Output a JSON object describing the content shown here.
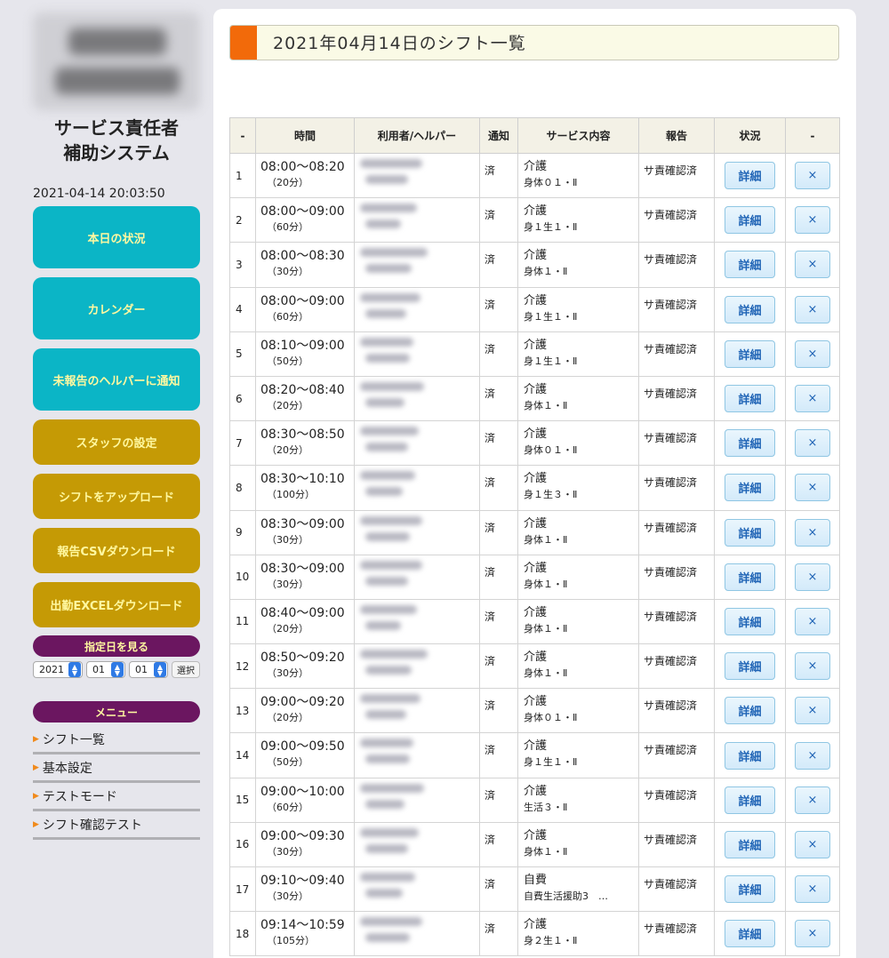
{
  "sidebar": {
    "app_title_line1": "サービス責任者",
    "app_title_line2": "補助システム",
    "datetime": "2021-04-14 20:03:50",
    "nav_buttons": [
      {
        "label": "本日の状況"
      },
      {
        "label": "カレンダー"
      },
      {
        "label": "未報告のヘルパーに通知"
      },
      {
        "label": "スタッフの設定"
      },
      {
        "label": "シフトをアップロード"
      },
      {
        "label": "報告CSVダウンロード"
      },
      {
        "label": "出勤EXCELダウンロード"
      }
    ],
    "date_picker": {
      "heading": "指定日を見る",
      "year": "2021",
      "month": "01",
      "day": "01",
      "select_label": "選択"
    },
    "menu": {
      "heading": "メニュー",
      "items": [
        {
          "label": "シフト一覧"
        },
        {
          "label": "基本設定"
        },
        {
          "label": "テストモード"
        },
        {
          "label": "シフト確認テスト"
        }
      ]
    }
  },
  "main": {
    "title": "2021年04月14日のシフト一覧",
    "table": {
      "headers": [
        "-",
        "時間",
        "利用者/ヘルパー",
        "通知",
        "サービス内容",
        "報告",
        "状況",
        "-"
      ],
      "detail_label": "詳細",
      "delete_label": "×",
      "rows": [
        {
          "no": "1",
          "time": "08:00〜08:20",
          "duration": "（20分）",
          "notice": "済",
          "category": "介護",
          "detail": "身体０１・Ⅱ",
          "report": "サ責確認済"
        },
        {
          "no": "2",
          "time": "08:00〜09:00",
          "duration": "（60分）",
          "notice": "済",
          "category": "介護",
          "detail": "身１生１・Ⅱ",
          "report": "サ責確認済"
        },
        {
          "no": "3",
          "time": "08:00〜08:30",
          "duration": "（30分）",
          "notice": "済",
          "category": "介護",
          "detail": "身体１・Ⅱ",
          "report": "サ責確認済"
        },
        {
          "no": "4",
          "time": "08:00〜09:00",
          "duration": "（60分）",
          "notice": "済",
          "category": "介護",
          "detail": "身１生１・Ⅱ",
          "report": "サ責確認済"
        },
        {
          "no": "5",
          "time": "08:10〜09:00",
          "duration": "（50分）",
          "notice": "済",
          "category": "介護",
          "detail": "身１生１・Ⅱ",
          "report": "サ責確認済"
        },
        {
          "no": "6",
          "time": "08:20〜08:40",
          "duration": "（20分）",
          "notice": "済",
          "category": "介護",
          "detail": "身体１・Ⅱ",
          "report": "サ責確認済"
        },
        {
          "no": "7",
          "time": "08:30〜08:50",
          "duration": "（20分）",
          "notice": "済",
          "category": "介護",
          "detail": "身体０１・Ⅱ",
          "report": "サ責確認済"
        },
        {
          "no": "8",
          "time": "08:30〜10:10",
          "duration": "（100分）",
          "notice": "済",
          "category": "介護",
          "detail": "身１生３・Ⅱ",
          "report": "サ責確認済"
        },
        {
          "no": "9",
          "time": "08:30〜09:00",
          "duration": "（30分）",
          "notice": "済",
          "category": "介護",
          "detail": "身体１・Ⅱ",
          "report": "サ責確認済"
        },
        {
          "no": "10",
          "time": "08:30〜09:00",
          "duration": "（30分）",
          "notice": "済",
          "category": "介護",
          "detail": "身体１・Ⅱ",
          "report": "サ責確認済"
        },
        {
          "no": "11",
          "time": "08:40〜09:00",
          "duration": "（20分）",
          "notice": "済",
          "category": "介護",
          "detail": "身体１・Ⅱ",
          "report": "サ責確認済"
        },
        {
          "no": "12",
          "time": "08:50〜09:20",
          "duration": "（30分）",
          "notice": "済",
          "category": "介護",
          "detail": "身体１・Ⅱ",
          "report": "サ責確認済"
        },
        {
          "no": "13",
          "time": "09:00〜09:20",
          "duration": "（20分）",
          "notice": "済",
          "category": "介護",
          "detail": "身体０１・Ⅱ",
          "report": "サ責確認済"
        },
        {
          "no": "14",
          "time": "09:00〜09:50",
          "duration": "（50分）",
          "notice": "済",
          "category": "介護",
          "detail": "身１生１・Ⅱ",
          "report": "サ責確認済"
        },
        {
          "no": "15",
          "time": "09:00〜10:00",
          "duration": "（60分）",
          "notice": "済",
          "category": "介護",
          "detail": "生活３・Ⅱ",
          "report": "サ責確認済"
        },
        {
          "no": "16",
          "time": "09:00〜09:30",
          "duration": "（30分）",
          "notice": "済",
          "category": "介護",
          "detail": "身体１・Ⅱ",
          "report": "サ責確認済"
        },
        {
          "no": "17",
          "time": "09:10〜09:40",
          "duration": "（30分）",
          "notice": "済",
          "category": "自費",
          "detail": "自費生活援助3　…",
          "report": "サ責確認済"
        },
        {
          "no": "18",
          "time": "09:14〜10:59",
          "duration": "（105分）",
          "notice": "済",
          "category": "介護",
          "detail": "身２生１・Ⅱ",
          "report": "サ責確認済"
        }
      ]
    }
  }
}
